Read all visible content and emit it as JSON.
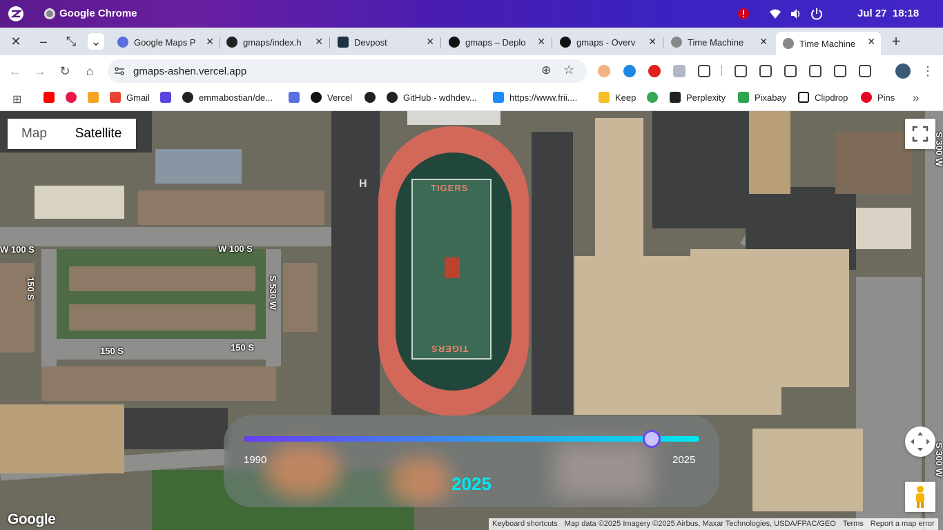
{
  "os": {
    "app_name": "Google Chrome",
    "date": "Jul 27",
    "time": "18:18"
  },
  "tabs": [
    {
      "label": "Google Maps P",
      "fav_color": "#5b6ee0"
    },
    {
      "label": "gmaps/index.h",
      "fav_color": "#222222"
    },
    {
      "label": "Devpost",
      "fav_color": "#1c3340"
    },
    {
      "label": "gmaps – Deplo",
      "fav_color": "#111111"
    },
    {
      "label": "gmaps - Overv",
      "fav_color": "#111111"
    },
    {
      "label": "Time Machine",
      "fav_color": "#888888"
    },
    {
      "label": "Time Machine",
      "fav_color": "#888888"
    }
  ],
  "toolbar": {
    "url": "gmaps-ashen.vercel.app"
  },
  "bookmarks": [
    {
      "label": "",
      "color": "#ff0000"
    },
    {
      "label": "",
      "color": "#e8174b"
    },
    {
      "label": "",
      "color": "#f4a623"
    },
    {
      "label": "Gmail",
      "color": "#ea4335"
    },
    {
      "label": "",
      "color": "#5a44e0"
    },
    {
      "label": "emmabostian/de...",
      "color": "#222222"
    },
    {
      "label": "",
      "color": "#5b6ee0"
    },
    {
      "label": "Vercel",
      "color": "#111111"
    },
    {
      "label": "",
      "color": "#222222"
    },
    {
      "label": "GitHub - wdhdev...",
      "color": "#222222"
    },
    {
      "label": "https://www.frii....",
      "color": "#1a8cff"
    },
    {
      "label": "Keep",
      "color": "#f6bf26"
    },
    {
      "label": "",
      "color": "#34a853"
    },
    {
      "label": "Perplexity",
      "color": "#222222"
    },
    {
      "label": "Pixabay",
      "color": "#2ea44f"
    },
    {
      "label": "Clipdrop",
      "color": "#111111"
    },
    {
      "label": "Pins",
      "color": "#e60023"
    }
  ],
  "map": {
    "toggle": {
      "map_label": "Map",
      "satellite_label": "Satellite",
      "selected": "Satellite"
    },
    "streets": [
      "W 100 S",
      "W 100 S",
      "150 S",
      "150 S",
      "150 S",
      "S 530 W",
      "S 300 W",
      "S 300 W"
    ],
    "field_text_top": "TIGERS",
    "field_text_bottom": "TIGERS",
    "field_letter": "H",
    "google_logo": "Google",
    "attribution": [
      "Keyboard shortcuts",
      "Map data ©2025 Imagery ©2025 Airbus, Maxar Technologies, USDA/FPAC/GEO",
      "Terms",
      "Report a map error"
    ]
  },
  "time_slider": {
    "min_label": "1990",
    "max_label": "2025",
    "min": 1990,
    "max": 2025,
    "value": 2025,
    "current_label": "2025",
    "thumb_fraction": 0.895,
    "accent_start": "#6a3df0",
    "accent_end": "#00e8f0"
  }
}
